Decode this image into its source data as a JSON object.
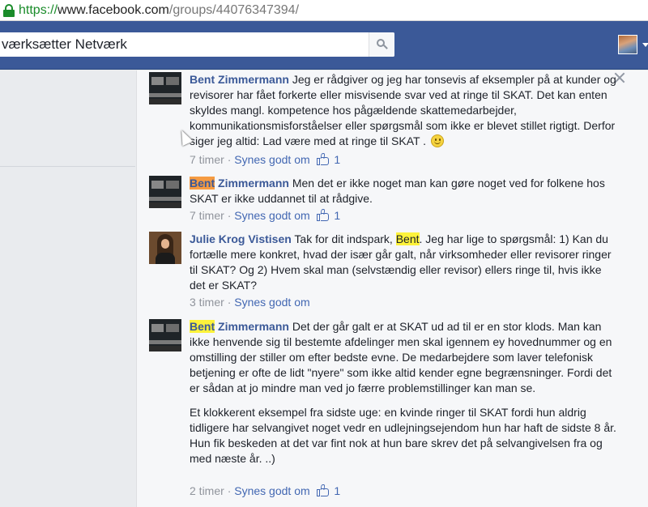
{
  "browser": {
    "url_scheme": "https://",
    "url_host": "www.facebook.com",
    "url_path": "/groups/44076347394/"
  },
  "header": {
    "search_value": "værksætter Netværk",
    "brand_color": "#3b5998"
  },
  "comments": [
    {
      "author_first": "Bent",
      "author_last": "Zimmermann",
      "text": "Jeg er rådgiver og jeg har tonsevis af eksempler på at kunder og revisorer har fået forkerte eller misvisende svar ved at ringe til SKAT. Det kan enten skyldes mangl. kompetence hos pågældende skattemedarbejder, kommunikationsmisforståelser eller spørgsmål som ikke er blevet stillet rigtigt. Derfor siger jeg altid: Lad være med at ringe til SKAT .",
      "time": "7 timer",
      "like_label": "Synes godt om",
      "like_count": "1"
    },
    {
      "author_first": "Bent",
      "author_last": "Zimmermann",
      "text": "Men det er ikke noget man kan gøre noget ved for folkene hos SKAT er ikke uddannet til at rådgive.",
      "time": "7 timer",
      "like_label": "Synes godt om",
      "like_count": "1"
    },
    {
      "author": "Julie Krog Vistisen",
      "text_before": "Tak for dit indspark,",
      "mention": "Bent",
      "text_after": ". Jeg har lige to spørgsmål: 1) Kan du fortælle mere konkret, hvad der især går galt, når virksomheder eller revisorer ringer til SKAT? Og 2) Hvem skal man (selvstændig eller revisor) ellers ringe til, hvis ikke det er SKAT?",
      "time": "3 timer",
      "like_label": "Synes godt om"
    },
    {
      "author_first": "Bent",
      "author_last": "Zimmermann",
      "text": "Det der går galt er at SKAT ud ad til er en stor klods. Man kan ikke henvende sig til bestemte afdelinger men skal igennem ey hovednummer og en omstilling der stiller om efter bedste evne. De medarbejdere som laver telefonisk betjening er ofte de lidt \"nyere\" som ikke altid kender egne begrænsninger. Fordi det er sådan at jo mindre man ved jo færre problemstillinger kan man se.",
      "text2": "Et klokkerent eksempel fra sidste uge: en kvinde ringer til SKAT fordi hun aldrig tidligere har selvangivet noget vedr en udlejningsejendom hun har haft de sidste 8 år. Hun fik beskeden at det var fint nok at hun bare skrev det på selvangivelsen fra og med næste år. ..)",
      "time": "2 timer",
      "like_label": "Synes godt om",
      "like_count": "1"
    }
  ]
}
